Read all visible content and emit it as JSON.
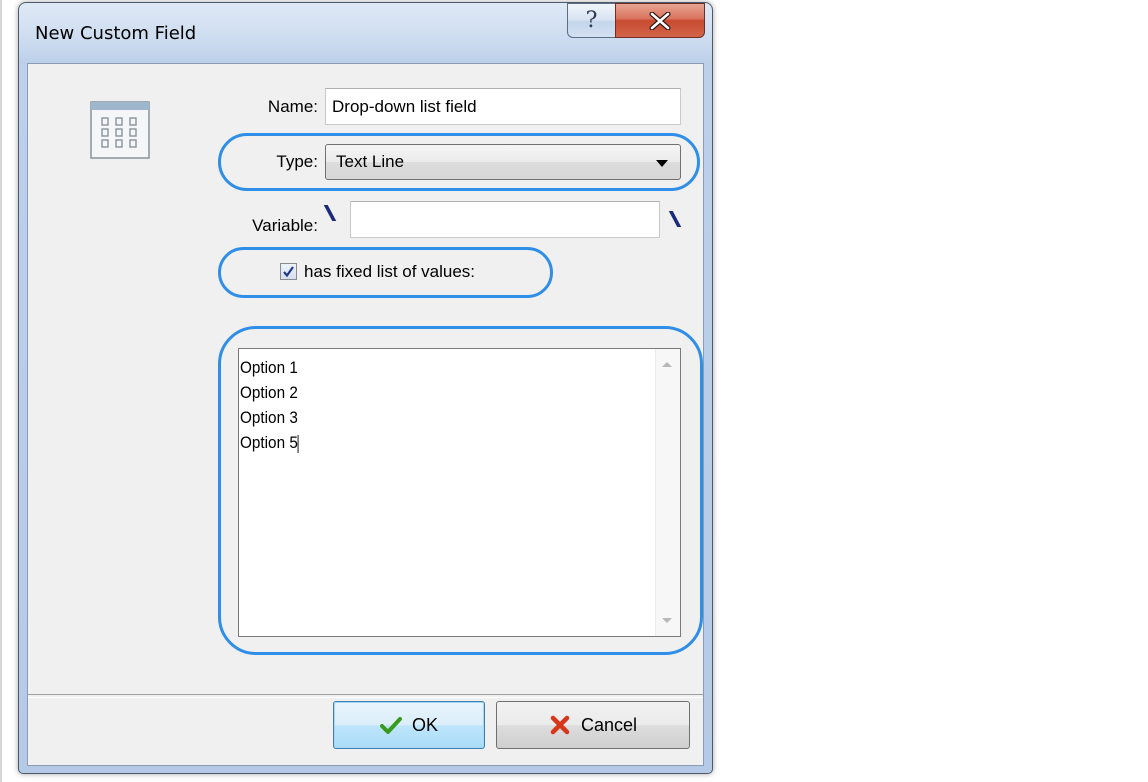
{
  "window": {
    "title": "New Custom Field",
    "help_glyph": "?",
    "close_icon": "close-x-icon"
  },
  "form": {
    "name_label": "Name:",
    "name_value": "Drop-down list field",
    "type_label": "Type:",
    "type_value": "Text Line",
    "variable_label": "Variable:",
    "variable_value": "",
    "fixed_list_label": "has fixed list of values:",
    "fixed_list_checked": true,
    "values_text": "Option 1\nOption 2\nOption 3\nOption 5"
  },
  "buttons": {
    "ok_label": "OK",
    "cancel_label": "Cancel"
  },
  "colors": {
    "highlight": "#2f8ee8",
    "ok_check": "#3a9a1c",
    "cancel_x": "#d8361a",
    "close_button": "#c74a30"
  }
}
